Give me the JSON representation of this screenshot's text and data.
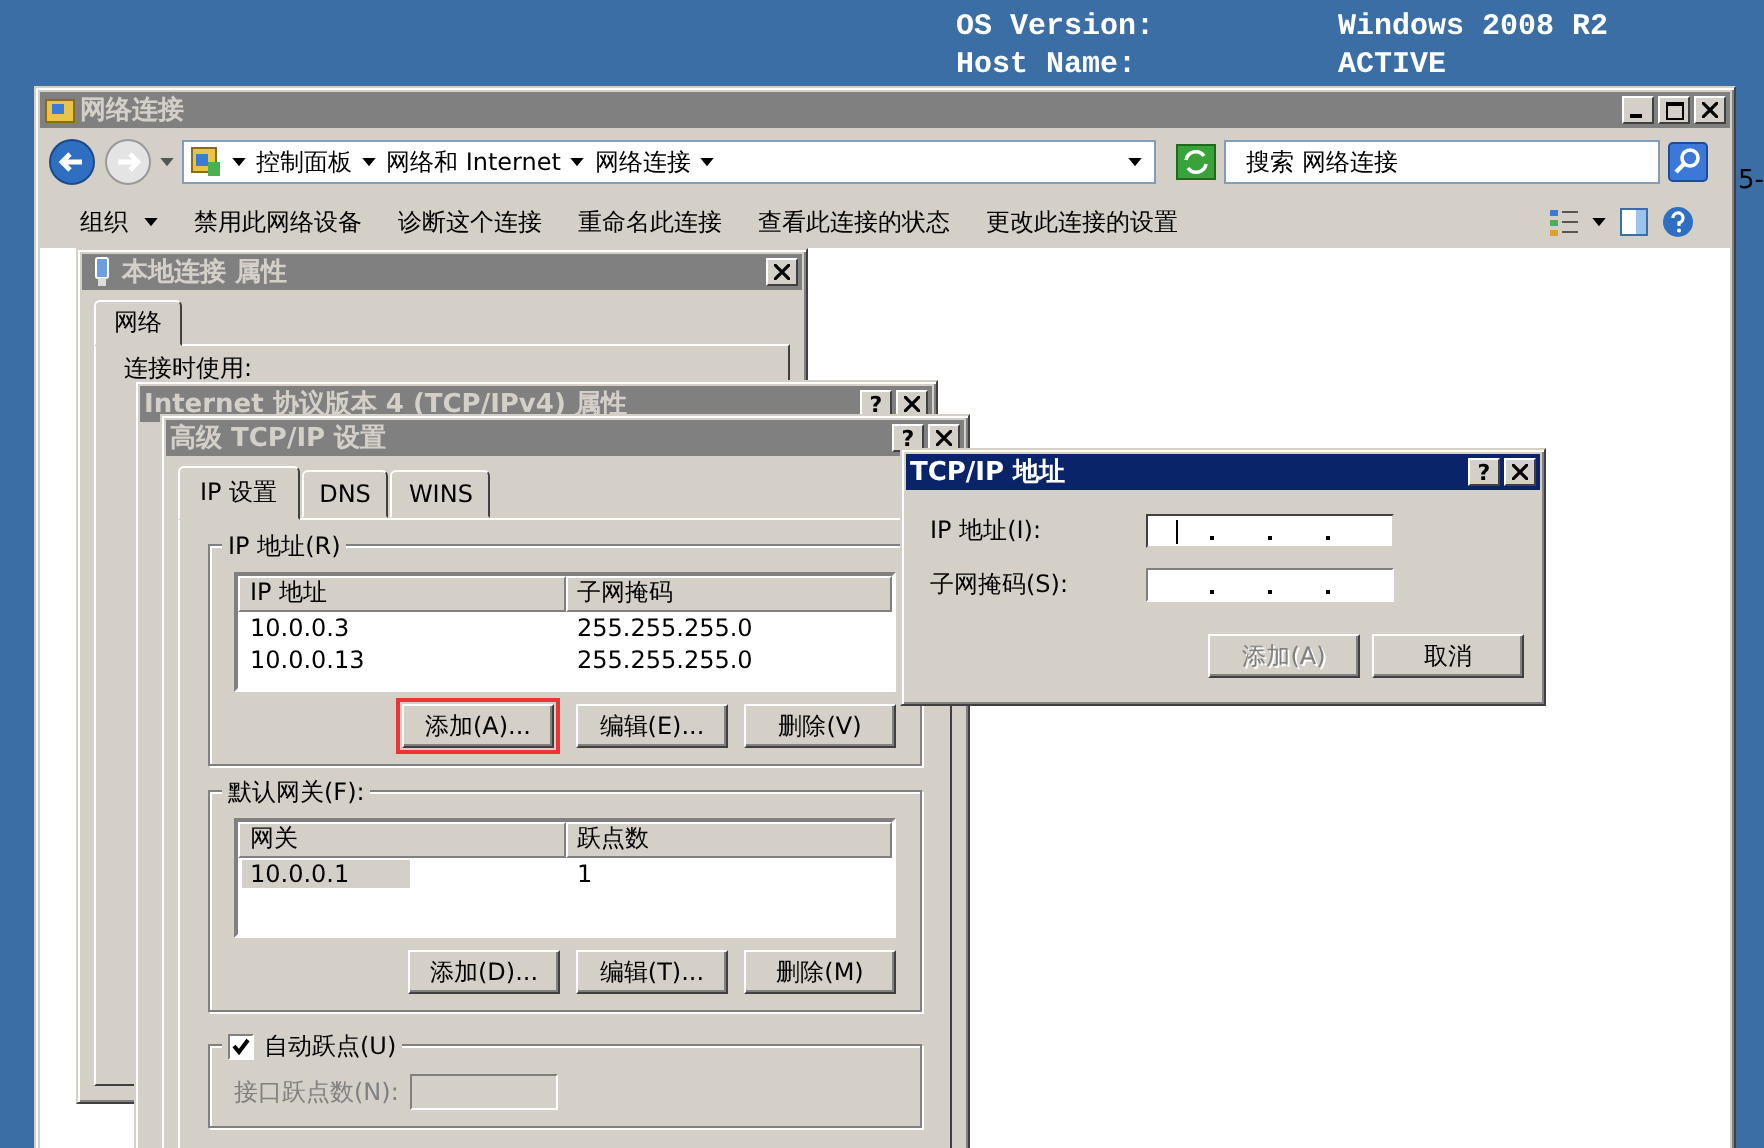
{
  "desktop": {
    "info": [
      {
        "label": "OS Version:",
        "value": "Windows 2008 R2"
      },
      {
        "label": "Host Name:",
        "value": "ACTIVE"
      }
    ],
    "edge_text": "5-"
  },
  "explorer": {
    "title": "网络连接",
    "active": false,
    "breadcrumb": [
      "控制面板",
      "网络和 Internet",
      "网络连接"
    ],
    "search": {
      "placeholder": "搜索 网络连接"
    },
    "toolbar": [
      {
        "label": "组织",
        "dropdown": true
      },
      {
        "label": "禁用此网络设备",
        "dropdown": false
      },
      {
        "label": "诊断这个连接",
        "dropdown": false
      },
      {
        "label": "重命名此连接",
        "dropdown": false
      },
      {
        "label": "查看此连接的状态",
        "dropdown": false
      },
      {
        "label": "更改此连接的设置",
        "dropdown": false
      }
    ]
  },
  "properties_dialog": {
    "title": "本地连接 属性",
    "active": false,
    "tabs": [
      {
        "label": "网络",
        "selected": true
      }
    ],
    "connect_using_label": "连接时使用:"
  },
  "ipv4_dialog": {
    "title": "Internet 协议版本 4 (TCP/IPv4) 属性",
    "active": false,
    "help_button": "?"
  },
  "advanced_dialog": {
    "title": "高级 TCP/IP 设置",
    "active": false,
    "help_button": "?",
    "tabs": [
      {
        "label": "IP 设置",
        "selected": true
      },
      {
        "label": "DNS",
        "selected": false
      },
      {
        "label": "WINS",
        "selected": false
      }
    ],
    "ip_addresses": {
      "label": "IP 地址(R)",
      "columns": [
        "IP 地址",
        "子网掩码"
      ],
      "rows": [
        {
          "cells": [
            "10.0.0.3",
            "255.255.255.0"
          ],
          "selected": false
        },
        {
          "cells": [
            "10.0.0.13",
            "255.255.255.0"
          ],
          "selected": false
        }
      ],
      "buttons": [
        {
          "label": "添加(A)...",
          "highlighted": true
        },
        {
          "label": "编辑(E)...",
          "highlighted": false
        },
        {
          "label": "删除(V)",
          "highlighted": false
        }
      ]
    },
    "gateways": {
      "label": "默认网关(F):",
      "columns": [
        "网关",
        "跃点数"
      ],
      "rows": [
        {
          "cells": [
            "10.0.0.1",
            "1"
          ],
          "selected": true
        }
      ],
      "buttons": [
        {
          "label": "添加(D)...",
          "highlighted": false
        },
        {
          "label": "编辑(T)...",
          "highlighted": false
        },
        {
          "label": "删除(M)",
          "highlighted": false
        }
      ]
    },
    "automatic_metric": {
      "label": "自动跃点(U)",
      "checked": true
    },
    "interface_metric": {
      "label": "接口跃点数(N):",
      "disabled": true
    }
  },
  "address_dialog": {
    "title": "TCP/IP 地址",
    "active": true,
    "help_button": "?",
    "fields": [
      {
        "label": "IP 地址(I):",
        "focused": true
      },
      {
        "label": "子网掩码(S):",
        "focused": false
      }
    ],
    "buttons": [
      {
        "label": "添加(A)",
        "disabled": true
      },
      {
        "label": "取消",
        "disabled": false
      }
    ]
  }
}
